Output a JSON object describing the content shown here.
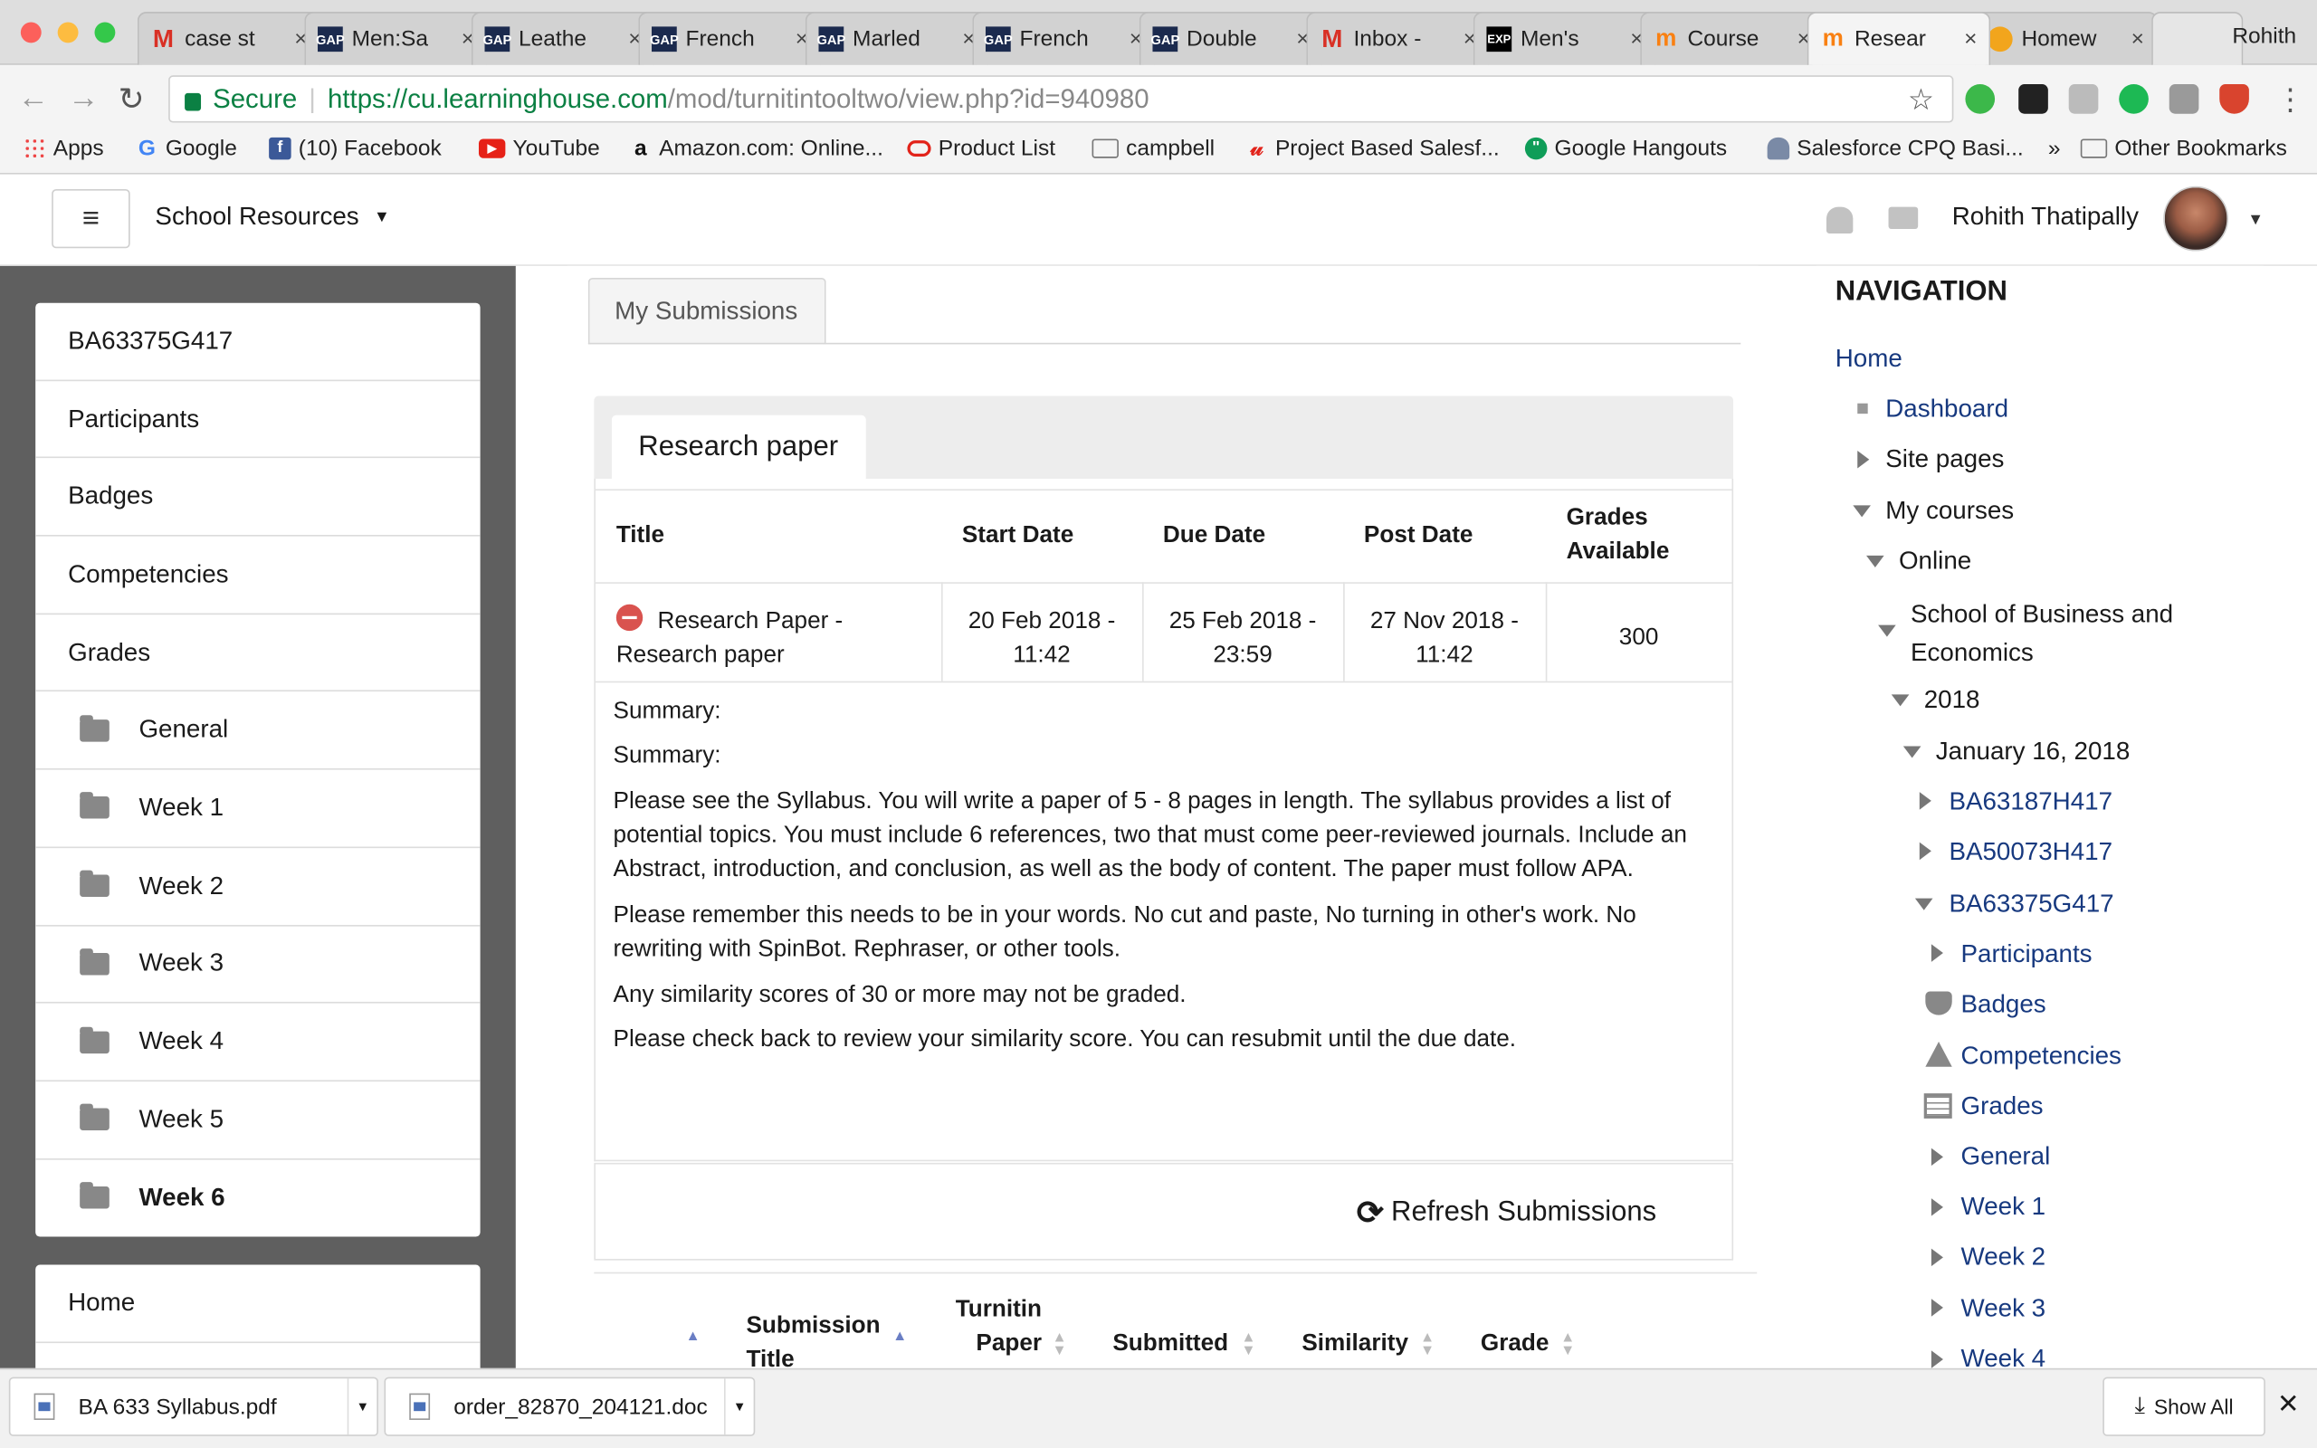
{
  "browser": {
    "tabs": [
      {
        "title": "case st",
        "icon": "gmail-icon"
      },
      {
        "title": "Men:Sa",
        "icon": "gap-icon"
      },
      {
        "title": "Leathe",
        "icon": "gap-icon"
      },
      {
        "title": "French",
        "icon": "gap-icon"
      },
      {
        "title": "Marled",
        "icon": "gap-icon"
      },
      {
        "title": "French",
        "icon": "gap-icon"
      },
      {
        "title": "Double",
        "icon": "gap-icon"
      },
      {
        "title": "Inbox -",
        "icon": "gmail-icon"
      },
      {
        "title": "Men's",
        "icon": "express-icon"
      },
      {
        "title": "Course",
        "icon": "moodle-icon"
      },
      {
        "title": "Resear",
        "icon": "moodle-icon",
        "active": true
      },
      {
        "title": "Homew",
        "icon": "homework-icon"
      }
    ],
    "profile_name": "Rohith",
    "secure_label": "Secure",
    "url_host": "https://cu.learninghouse.com",
    "url_path": "/mod/turnitintooltwo/view.php?id=940980",
    "bookmarks": [
      "Apps",
      "Google",
      "(10) Facebook",
      "YouTube",
      "Amazon.com: Online...",
      "Product List",
      "campbell",
      "Project Based Salesf...",
      "Google Hangouts",
      "Salesforce CPQ Basi..."
    ],
    "more_bookmarks": "»",
    "other_bookmarks": "Other Bookmarks"
  },
  "navbar": {
    "menu_label": "School Resources",
    "user_name": "Rohith Thatipally"
  },
  "drawer": {
    "course_items": [
      "BA63375G417",
      "Participants",
      "Badges",
      "Competencies",
      "Grades"
    ],
    "sections": [
      "General",
      "Week 1",
      "Week 2",
      "Week 3",
      "Week 4",
      "Week 5",
      "Week 6"
    ],
    "active_section": "Week 6",
    "home_label": "Home"
  },
  "main": {
    "tab_label": "My Submissions",
    "panel_tab": "Research paper",
    "table": {
      "headers": [
        "Title",
        "Start Date",
        "Due Date",
        "Post Date",
        "Grades Available"
      ],
      "row": {
        "title_line1": "Research Paper -",
        "title_line2": "Research paper",
        "start_line1": "20 Feb 2018 -",
        "start_line2": "11:42",
        "due_line1": "25 Feb 2018 -",
        "due_line2": "23:59",
        "post_line1": "27 Nov 2018 -",
        "post_line2": "11:42",
        "grades": "300"
      }
    },
    "summary_label_1": "Summary:",
    "summary_label_2": "Summary:",
    "paragraphs": [
      "Please see the Syllabus. You will write a paper of 5 - 8 pages in length. The syllabus provides a list of potential topics. You must include 6 references, two that must come peer-reviewed journals. Include an Abstract, introduction, and conclusion, as well as the body of content. The paper must follow APA.",
      "Please remember this needs to be in your words.  No cut and paste, No turning in other's work.  No rewriting with SpinBot. Rephraser, or other tools.",
      "Any similarity scores of 30 or more may not be graded.",
      "Please check back to review your similarity score.  You can resubmit until the due date."
    ],
    "refresh_label": "Refresh Submissions",
    "submissions_headers": {
      "title_line1": "Submission",
      "title_line2": "Title",
      "paper_line1": "Turnitin",
      "paper_line2": "Paper",
      "submitted": "Submitted",
      "similarity": "Similarity",
      "grade": "Grade"
    }
  },
  "rightnav": {
    "heading": "NAVIGATION",
    "home": "Home",
    "dashboard": "Dashboard",
    "site_pages": "Site pages",
    "my_courses": "My courses",
    "online": "Online",
    "school_line1": "School of Business and",
    "school_line2": "Economics",
    "year": "2018",
    "term": "January 16, 2018",
    "courses": [
      "BA63187H417",
      "BA50073H417",
      "BA63375G417"
    ],
    "course_children": [
      "Participants",
      "Badges",
      "Competencies",
      "Grades",
      "General",
      "Week 1",
      "Week 2",
      "Week 3",
      "Week 4"
    ]
  },
  "downloads": {
    "files": [
      "BA 633 Syllabus.pdf",
      "order_82870_204121.doc"
    ],
    "show_all": "Show All"
  }
}
